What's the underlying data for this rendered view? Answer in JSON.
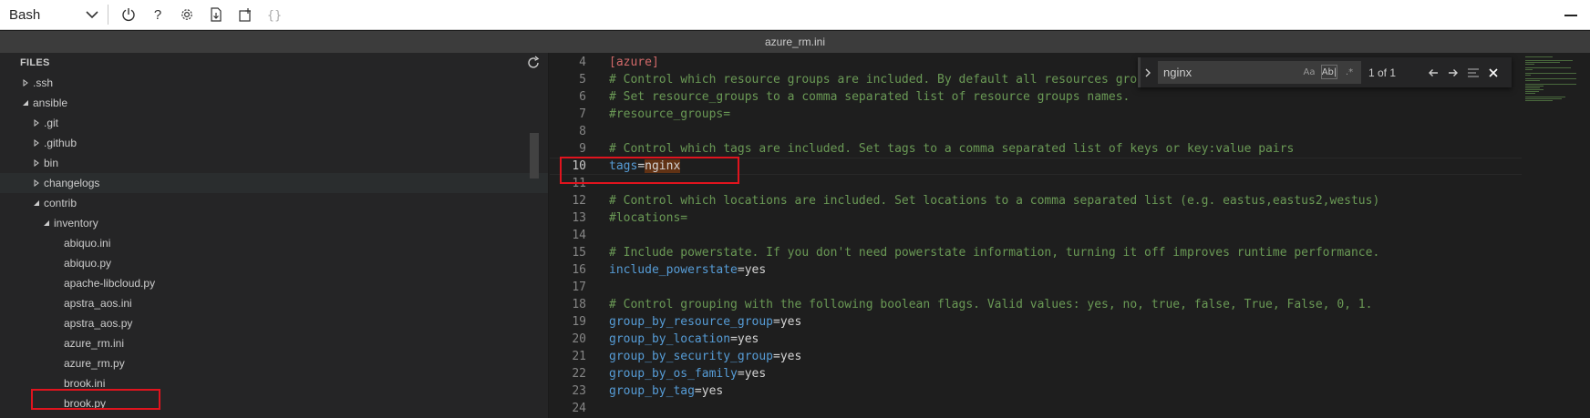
{
  "toolbar": {
    "shell": "Bash",
    "icons": [
      "power-icon",
      "help-icon",
      "settings-icon",
      "upload-download-icon",
      "open-new-session-icon",
      "braces-icon"
    ]
  },
  "title": "azure_rm.ini",
  "sidebar": {
    "header": "FILES",
    "items": [
      {
        "label": ".ssh",
        "depth": 0,
        "expanded": false
      },
      {
        "label": "ansible",
        "depth": 0,
        "expanded": true
      },
      {
        "label": ".git",
        "depth": 1,
        "expanded": false
      },
      {
        "label": ".github",
        "depth": 1,
        "expanded": false
      },
      {
        "label": "bin",
        "depth": 1,
        "expanded": false
      },
      {
        "label": "changelogs",
        "depth": 1,
        "expanded": false
      },
      {
        "label": "contrib",
        "depth": 1,
        "expanded": true
      },
      {
        "label": "inventory",
        "depth": 2,
        "expanded": true
      },
      {
        "label": "abiquo.ini",
        "depth": 3,
        "file": true
      },
      {
        "label": "abiquo.py",
        "depth": 3,
        "file": true
      },
      {
        "label": "apache-libcloud.py",
        "depth": 3,
        "file": true
      },
      {
        "label": "apstra_aos.ini",
        "depth": 3,
        "file": true
      },
      {
        "label": "apstra_aos.py",
        "depth": 3,
        "file": true
      },
      {
        "label": "azure_rm.ini",
        "depth": 3,
        "file": true
      },
      {
        "label": "azure_rm.py",
        "depth": 3,
        "file": true
      },
      {
        "label": "brook.ini",
        "depth": 3,
        "file": true
      },
      {
        "label": "brook.py",
        "depth": 3,
        "file": true
      }
    ]
  },
  "editor": {
    "current_line": "10",
    "lines": [
      {
        "n": "4",
        "parts": [
          {
            "t": "[azure]",
            "c": "section"
          }
        ]
      },
      {
        "n": "5",
        "parts": [
          {
            "t": "# Control which resource groups are included. By default all resources groups are included.",
            "c": "comment"
          }
        ]
      },
      {
        "n": "6",
        "parts": [
          {
            "t": "# Set resource_groups to a comma separated list of resource groups names.",
            "c": "comment"
          }
        ]
      },
      {
        "n": "7",
        "parts": [
          {
            "t": "#resource_groups=",
            "c": "comment"
          }
        ]
      },
      {
        "n": "8",
        "parts": []
      },
      {
        "n": "9",
        "parts": [
          {
            "t": "# Control which tags are included. Set tags to a comma separated list of keys or key:value pairs",
            "c": "comment"
          }
        ]
      },
      {
        "n": "10",
        "parts": [
          {
            "t": "tags",
            "c": "key"
          },
          {
            "t": "=",
            "c": "eq"
          },
          {
            "t": "nginx",
            "c": "match"
          }
        ]
      },
      {
        "n": "11",
        "parts": []
      },
      {
        "n": "12",
        "parts": [
          {
            "t": "# Control which locations are included. Set locations to a comma separated list (e.g. eastus,eastus2,westus)",
            "c": "comment"
          }
        ]
      },
      {
        "n": "13",
        "parts": [
          {
            "t": "#locations=",
            "c": "comment"
          }
        ]
      },
      {
        "n": "14",
        "parts": []
      },
      {
        "n": "15",
        "parts": [
          {
            "t": "# Include powerstate. If you don't need powerstate information, turning it off improves runtime performance.",
            "c": "comment"
          }
        ]
      },
      {
        "n": "16",
        "parts": [
          {
            "t": "include_powerstate",
            "c": "key"
          },
          {
            "t": "=",
            "c": "eq"
          },
          {
            "t": "yes",
            "c": "val"
          }
        ]
      },
      {
        "n": "17",
        "parts": []
      },
      {
        "n": "18",
        "parts": [
          {
            "t": "# Control grouping with the following boolean flags. Valid values: yes, no, true, false, True, False, 0, 1.",
            "c": "comment"
          }
        ]
      },
      {
        "n": "19",
        "parts": [
          {
            "t": "group_by_resource_group",
            "c": "key"
          },
          {
            "t": "=",
            "c": "eq"
          },
          {
            "t": "yes",
            "c": "val"
          }
        ]
      },
      {
        "n": "20",
        "parts": [
          {
            "t": "group_by_location",
            "c": "key"
          },
          {
            "t": "=",
            "c": "eq"
          },
          {
            "t": "yes",
            "c": "val"
          }
        ]
      },
      {
        "n": "21",
        "parts": [
          {
            "t": "group_by_security_group",
            "c": "key"
          },
          {
            "t": "=",
            "c": "eq"
          },
          {
            "t": "yes",
            "c": "val"
          }
        ]
      },
      {
        "n": "22",
        "parts": [
          {
            "t": "group_by_os_family",
            "c": "key"
          },
          {
            "t": "=",
            "c": "eq"
          },
          {
            "t": "yes",
            "c": "val"
          }
        ]
      },
      {
        "n": "23",
        "parts": [
          {
            "t": "group_by_tag",
            "c": "key"
          },
          {
            "t": "=",
            "c": "eq"
          },
          {
            "t": "yes",
            "c": "val"
          }
        ]
      },
      {
        "n": "24",
        "parts": []
      }
    ]
  },
  "find": {
    "query": "nginx",
    "match_case": "Aa",
    "whole_word": "Ab|",
    "regex": ".*",
    "result": "1 of 1"
  },
  "colors": {
    "comment": "#6a9955",
    "key": "#569cd6",
    "section": "#d16969",
    "highlight_box": "#e0141e"
  }
}
